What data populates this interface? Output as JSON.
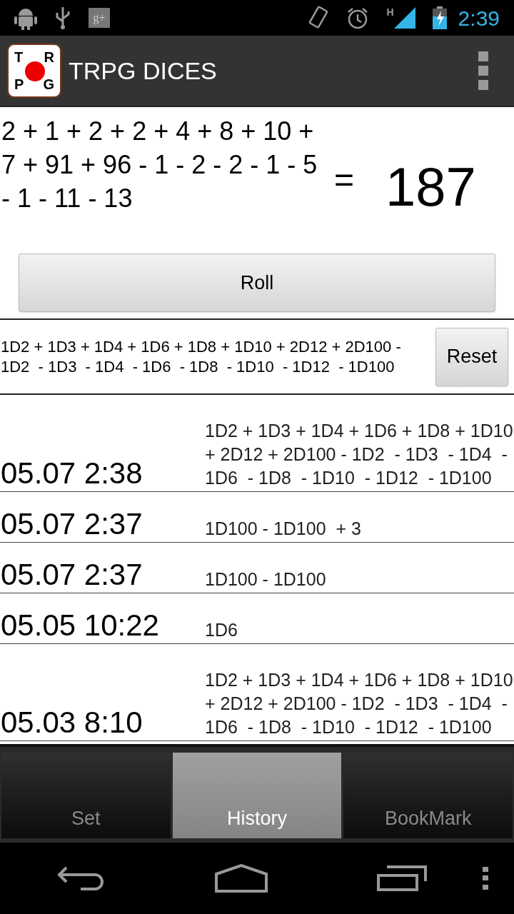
{
  "status_bar": {
    "badge": "g+",
    "time": "2:39",
    "network": "H"
  },
  "app_bar": {
    "logo_letters": [
      "T",
      "R",
      "P",
      "G"
    ],
    "title": "TRPG DICES"
  },
  "result": {
    "expression": "2 + 1 + 2 + 2 + 4 + 8 + 10 + 7 + 91 + 96 - 1 - 2 - 2 - 1 - 5 - 1 - 11 - 13",
    "equals": "=",
    "total": "187"
  },
  "roll_button": "Roll",
  "formula": {
    "text": "1D2 + 1D3 + 1D4 + 1D6 + 1D8 + 1D10 + 2D12 + 2D100 - 1D2  - 1D3  - 1D4  - 1D6  - 1D8  - 1D10  - 1D12  - 1D100",
    "reset_button": "Reset"
  },
  "history": [
    {
      "time": "05.07 2:38",
      "formula": "1D2 + 1D3 + 1D4 + 1D6 + 1D8 + 1D10 + 2D12 + 2D100 - 1D2  - 1D3  - 1D4  - 1D6  - 1D8  - 1D10  - 1D12  - 1D100"
    },
    {
      "time": "05.07 2:37",
      "formula": "1D100 - 1D100  + 3"
    },
    {
      "time": "05.07 2:37",
      "formula": "1D100 - 1D100"
    },
    {
      "time": "05.05 10:22",
      "formula": "1D6"
    },
    {
      "time": "05.03 8:10",
      "formula": "1D2 + 1D3 + 1D4 + 1D6 + 1D8 + 1D10 + 2D12 + 2D100 - 1D2  - 1D3  - 1D4  - 1D6  - 1D8  - 1D10  - 1D12  - 1D100"
    }
  ],
  "tabs": [
    {
      "label": "Set",
      "selected": false
    },
    {
      "label": "History",
      "selected": true
    },
    {
      "label": "BookMark",
      "selected": false
    }
  ]
}
